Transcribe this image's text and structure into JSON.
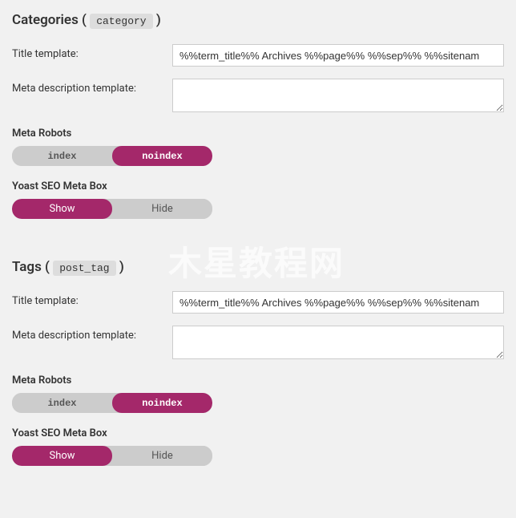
{
  "watermark": "木星教程网",
  "sections": {
    "categories": {
      "title": "Categories",
      "slug": "category",
      "title_template_label": "Title template:",
      "title_template_value": "%%term_title%% Archives %%page%% %%sep%% %%sitenam",
      "meta_desc_label": "Meta description template:",
      "meta_desc_value": "",
      "meta_robots_label": "Meta Robots",
      "meta_robots_option1": "index",
      "meta_robots_option2": "noindex",
      "meta_robots_active": "noindex",
      "yoast_box_label": "Yoast SEO Meta Box",
      "yoast_box_option1": "Show",
      "yoast_box_option2": "Hide",
      "yoast_box_active": "Show"
    },
    "tags": {
      "title": "Tags",
      "slug": "post_tag",
      "title_template_label": "Title template:",
      "title_template_value": "%%term_title%% Archives %%page%% %%sep%% %%sitenam",
      "meta_desc_label": "Meta description template:",
      "meta_desc_value": "",
      "meta_robots_label": "Meta Robots",
      "meta_robots_option1": "index",
      "meta_robots_option2": "noindex",
      "meta_robots_active": "noindex",
      "yoast_box_label": "Yoast SEO Meta Box",
      "yoast_box_option1": "Show",
      "yoast_box_option2": "Hide",
      "yoast_box_active": "Show"
    }
  }
}
